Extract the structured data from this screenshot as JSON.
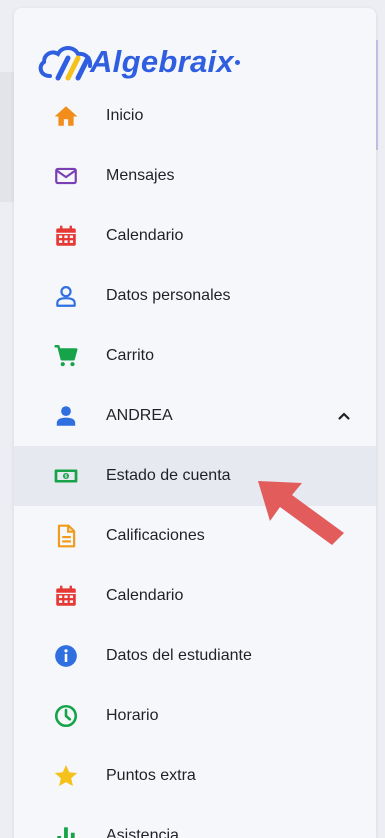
{
  "brand": {
    "name": "Algebraix",
    "colors": {
      "primary": "#2f5fe0",
      "accent": "#f4c21b"
    }
  },
  "nav": {
    "items": [
      {
        "label": "Inicio",
        "icon": "home-icon",
        "color": "#f28c1b"
      },
      {
        "label": "Mensajes",
        "icon": "envelope-icon",
        "color": "#7a3fb5"
      },
      {
        "label": "Calendario",
        "icon": "calendar-icon",
        "color": "#e53935"
      },
      {
        "label": "Datos personales",
        "icon": "user-outline-icon",
        "color": "#2f6fe0"
      },
      {
        "label": "Carrito",
        "icon": "cart-icon",
        "color": "#17a34a"
      },
      {
        "label": "ANDREA",
        "icon": "user-icon",
        "color": "#2f6fe0",
        "expanded": true
      },
      {
        "label": "Estado de cuenta",
        "icon": "money-icon",
        "color": "#17a34a",
        "active": true
      },
      {
        "label": "Calificaciones",
        "icon": "document-icon",
        "color": "#f29b1b"
      },
      {
        "label": "Calendario",
        "icon": "calendar-icon",
        "color": "#e53935"
      },
      {
        "label": "Datos del estudiante",
        "icon": "info-icon",
        "color": "#2f6fe0"
      },
      {
        "label": "Horario",
        "icon": "clock-icon",
        "color": "#17a34a"
      },
      {
        "label": "Puntos extra",
        "icon": "star-icon",
        "color": "#f4c21b"
      },
      {
        "label": "Asistencia",
        "icon": "chart-icon",
        "color": "#17a34a"
      }
    ]
  },
  "annotation": {
    "color": "#e25c5c"
  }
}
